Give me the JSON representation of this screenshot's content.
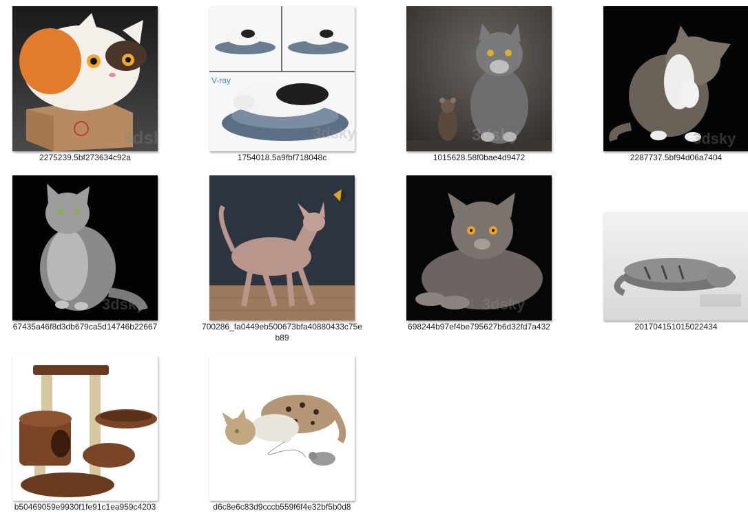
{
  "files": [
    {
      "name": "2275239.5bf273634c92a",
      "icon": "calico-cat-in-box-icon"
    },
    {
      "name": "1754018.5a9fbf718048c",
      "icon": "sleeping-cat-on-cushion-icon"
    },
    {
      "name": "1015628.58f0bae4d9472",
      "icon": "grey-cat-with-mouse-icon"
    },
    {
      "name": "2287737.5bf94d06a7404",
      "icon": "tabby-cat-licking-paw-icon"
    },
    {
      "name": "67435a46f8d3db679ca5d14746b22667",
      "icon": "fluffy-grey-cat-sitting-icon"
    },
    {
      "name": "700286_fa0449eb500673bfa40880433c75eb89",
      "icon": "sphynx-cat-with-butterfly-icon"
    },
    {
      "name": "698244b97ef4be795627b6d32fd7a432",
      "icon": "longhair-cat-lying-icon"
    },
    {
      "name": "201704151015022434",
      "icon": "tabby-cat-sleeping-icon"
    },
    {
      "name": "b50469059e9930f1fe91c1ea959c4203",
      "icon": "cat-tree-icon"
    },
    {
      "name": "d6c8e6c83d9cccb559f6f4e32bf5b0d8",
      "icon": "bengal-cat-with-toy-mouse-icon"
    }
  ],
  "colors": {
    "label": "#1e1e1e",
    "background": "#ffffff"
  }
}
